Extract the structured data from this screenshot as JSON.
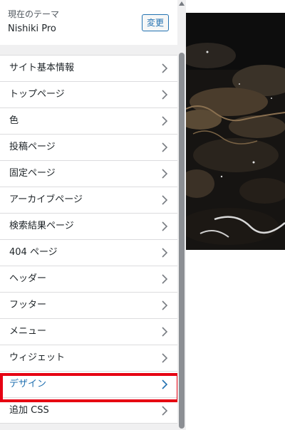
{
  "theme": {
    "caption": "現在のテーマ",
    "name": "Nishiki Pro",
    "change_label": "変更"
  },
  "menu": {
    "items": [
      {
        "label": "サイト基本情報"
      },
      {
        "label": "トップページ"
      },
      {
        "label": "色"
      },
      {
        "label": "投稿ページ"
      },
      {
        "label": "固定ページ"
      },
      {
        "label": "アーカイブページ"
      },
      {
        "label": "検索結果ページ"
      },
      {
        "label": "404 ページ"
      },
      {
        "label": "ヘッダー"
      },
      {
        "label": "フッター"
      },
      {
        "label": "メニュー"
      },
      {
        "label": "ウィジェット"
      },
      {
        "label": "デザイン",
        "highlighted": true
      },
      {
        "label": "追加 CSS"
      }
    ]
  },
  "colors": {
    "accent": "#2271b1",
    "highlight_border": "#e60012",
    "panel_bg": "#f0f0f1"
  },
  "icons": {
    "menu_item": "chevron-right-icon",
    "scroll_up": "triangle-up-icon"
  }
}
